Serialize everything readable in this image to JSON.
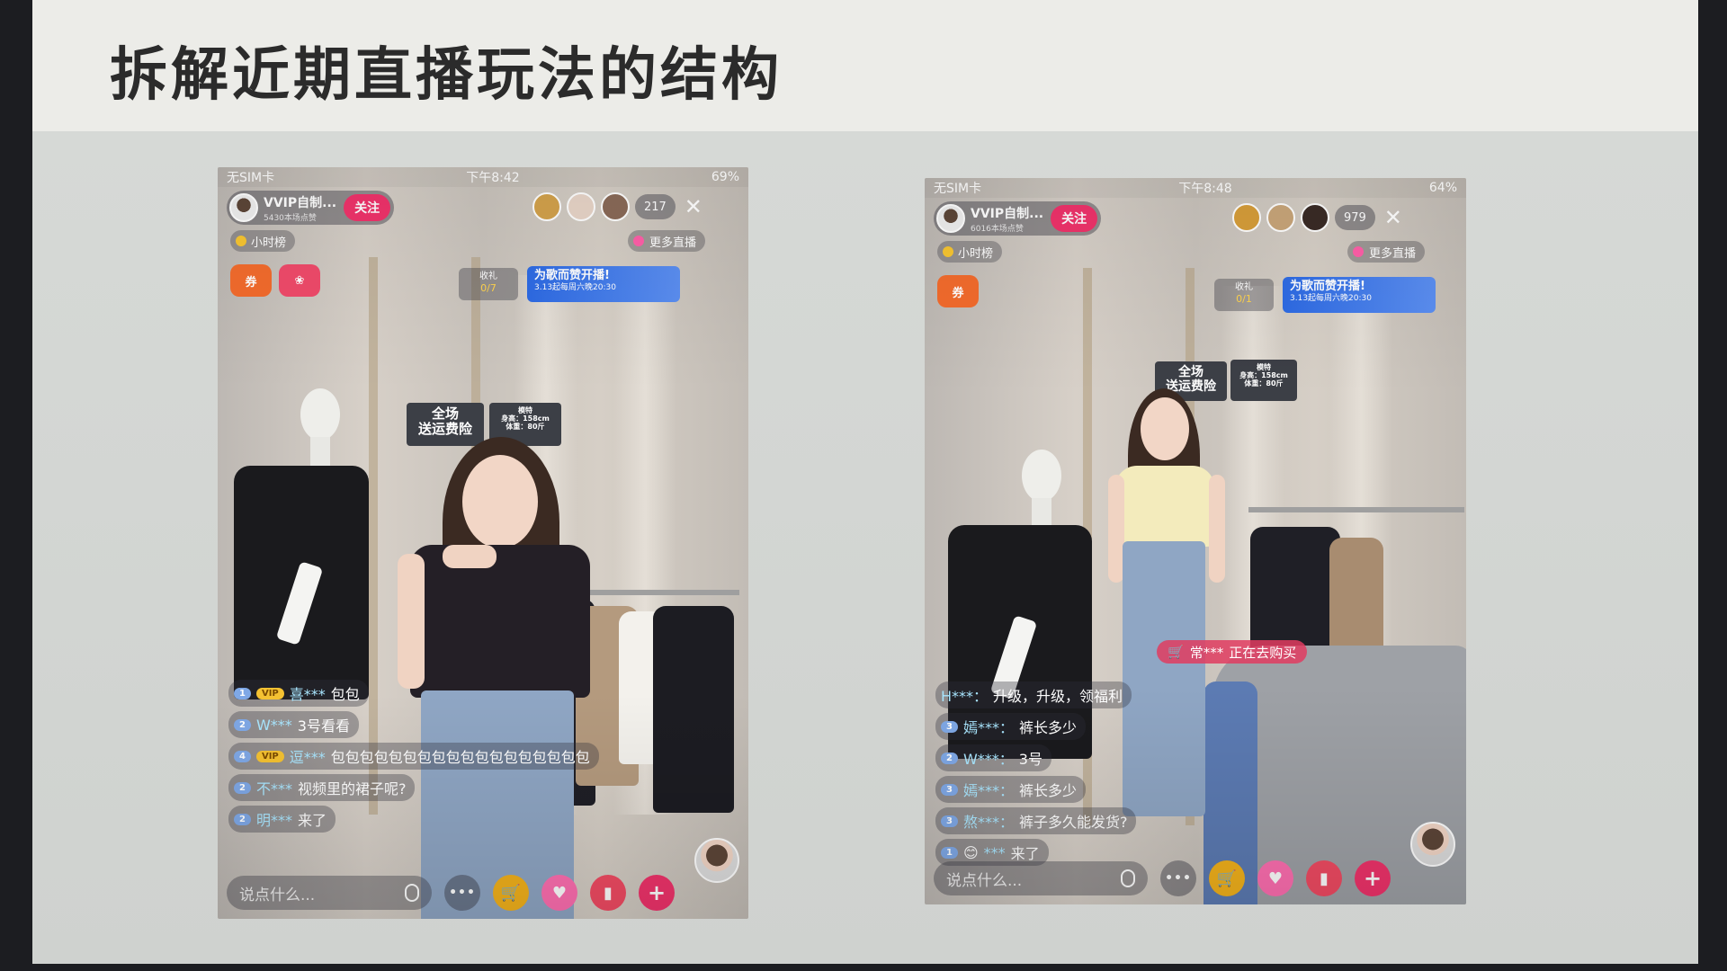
{
  "slide": {
    "title": "拆解近期直播玩法的结构"
  },
  "left_phone": {
    "status": {
      "carrier": "无SIM卡",
      "time": "下午8:42",
      "battery": "69%"
    },
    "host": {
      "name": "VVIP自制...",
      "sub": "5430本场点赞"
    },
    "follow_label": "关注",
    "viewer_count": "217",
    "close_label": "✕",
    "rank_label": "小时榜",
    "more_live_label": "更多直播",
    "gift_box": {
      "label": "收礼",
      "progress": "0/7"
    },
    "banner": {
      "line1": "为歌而赞开播!",
      "line2": "3.13起每周六晚20:30"
    },
    "signs": {
      "shipping": "全场\n送运费险",
      "model_info": "模特\n身高：158cm\n体重：80斤"
    },
    "chat": [
      {
        "level": "1",
        "vip": "VIP",
        "user": "喜***",
        "msg": "包包"
      },
      {
        "level": "2",
        "vip": "",
        "user": "W***",
        "msg": "3号看看"
      },
      {
        "level": "4",
        "vip": "VIP",
        "user": "逗***",
        "msg": "包包包包包包包包包包包包包包包包包包"
      },
      {
        "level": "2",
        "vip": "",
        "user": "不***",
        "msg": "视频里的裙子呢?"
      },
      {
        "level": "2",
        "vip": "",
        "user": "明***",
        "msg": "来了"
      }
    ],
    "input_placeholder": "说点什么...",
    "more_label": "•••",
    "plus_label": "+"
  },
  "right_phone": {
    "status": {
      "carrier": "无SIM卡",
      "time": "下午8:48",
      "battery": "64%"
    },
    "host": {
      "name": "VVIP自制...",
      "sub": "6016本场点赞"
    },
    "follow_label": "关注",
    "viewer_count": "979",
    "close_label": "✕",
    "rank_label": "小时榜",
    "more_live_label": "更多直播",
    "gift_box": {
      "label": "收礼",
      "progress": "0/1"
    },
    "banner": {
      "line1": "为歌而赞开播!",
      "line2": "3.13起每周六晚20:30"
    },
    "signs": {
      "shipping": "全场\n送运费险",
      "model_info": "模特\n身高：158cm\n体重：80斤"
    },
    "buying_notice": {
      "user": "常***",
      "msg": "正在去购买"
    },
    "chat": [
      {
        "level": "",
        "vip": "",
        "user": "H***：",
        "msg": "升级，升级，领福利"
      },
      {
        "level": "3",
        "vip": "",
        "user": "嫣***：",
        "msg": "裤长多少"
      },
      {
        "level": "2",
        "vip": "",
        "user": "W***：",
        "msg": "3号"
      },
      {
        "level": "3",
        "vip": "",
        "user": "嫣***：",
        "msg": "裤长多少"
      },
      {
        "level": "3",
        "vip": "",
        "user": "熬***：",
        "msg": "裤子多久能发货?"
      },
      {
        "level": "1",
        "vip": "",
        "user": "***",
        "msg": "来了"
      }
    ],
    "input_placeholder": "说点什么...",
    "more_label": "•••",
    "plus_label": "+"
  },
  "colors": {
    "follow": "#f0336b",
    "banner": "#2d6ae3",
    "cart": "#f3b21c"
  }
}
